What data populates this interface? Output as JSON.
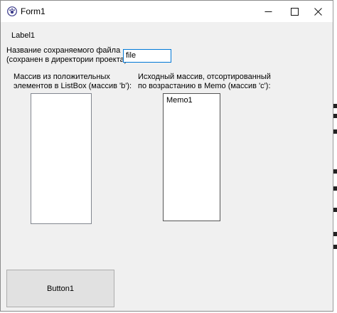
{
  "window": {
    "title": "Form1",
    "controls": {
      "minimize": "—",
      "maximize": "☐",
      "close": "✕"
    }
  },
  "form": {
    "label1": "Label1",
    "filename_label_line1": "Название сохраняемого файла",
    "filename_label_line2": "(сохранен в директории проекта):",
    "filename_value": "file",
    "listbox_label_line1": "Массив из положительных",
    "listbox_label_line2": "элементов в ListBox (массив 'b'):",
    "memo_label_line1": "Исходный массив, отсортированный",
    "memo_label_line2": "по возрастанию в Memo (массив 'c'):",
    "memo_text": "Memo1",
    "button1": "Button1"
  }
}
